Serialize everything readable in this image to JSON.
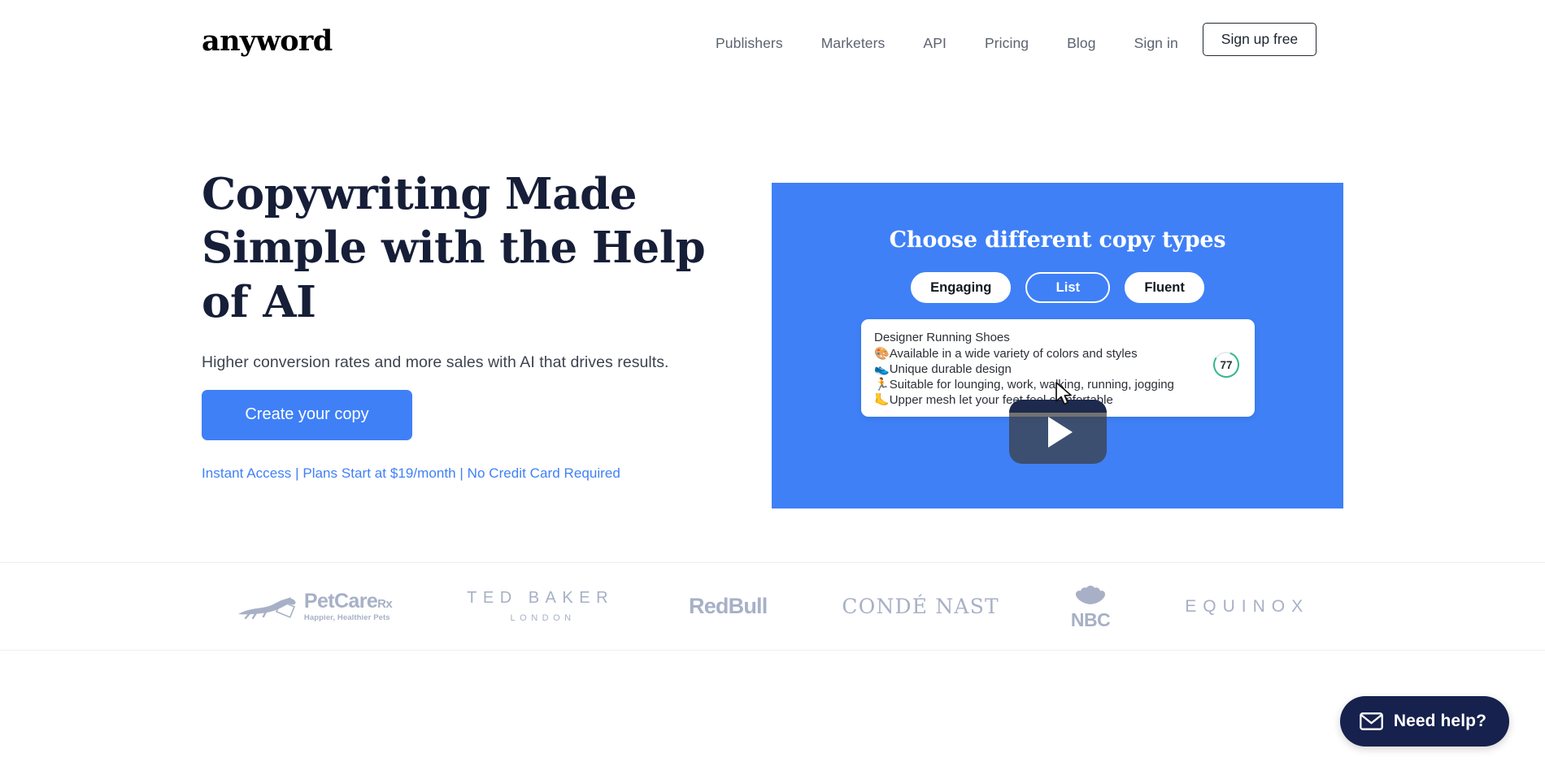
{
  "header": {
    "logo": "anyword",
    "nav": [
      {
        "label": "Publishers",
        "name": "nav-publishers"
      },
      {
        "label": "Marketers",
        "name": "nav-marketers"
      },
      {
        "label": "API",
        "name": "nav-api"
      },
      {
        "label": "Pricing",
        "name": "nav-pricing"
      },
      {
        "label": "Blog",
        "name": "nav-blog"
      }
    ],
    "sign_in": "Sign in",
    "sign_up": "Sign up free"
  },
  "hero": {
    "headline": "Copywriting Made Simple with the Help of AI",
    "subhead": "Higher conversion rates and more sales with AI that drives results.",
    "cta_label": "Create your copy",
    "cta_note": "Instant Access | Plans Start at $19/month | No Credit Card Required"
  },
  "video": {
    "title": "Choose different copy types",
    "pills": [
      {
        "label": "Engaging",
        "state": "filled"
      },
      {
        "label": "List",
        "state": "outlined"
      },
      {
        "label": "Fluent",
        "state": "filled"
      }
    ],
    "card": {
      "title": "Designer Running Shoes",
      "lines": [
        {
          "emoji": "🎨",
          "text": "Available in a wide variety of colors and styles"
        },
        {
          "emoji": "👟",
          "text": "Unique durable design"
        },
        {
          "emoji": "🏃",
          "text": "Suitable for lounging, work, walking, running, jogging"
        },
        {
          "emoji": "🦶",
          "text": "Upper mesh let your feet feel comfortable"
        }
      ],
      "score": "77"
    },
    "play_button": "play-button"
  },
  "logos": {
    "petcarerx": {
      "name": "PetCare",
      "suffix": "Rx",
      "tagline": "Happier, Healthier Pets"
    },
    "ted_baker": {
      "main": "TED BAKER",
      "sub": "LONDON"
    },
    "redbull": "RedBull",
    "conde_nast": "CONDÉ NAST",
    "nbc": "NBC",
    "equinox": "EQUINOX"
  },
  "help": {
    "label": "Need help?"
  },
  "colors": {
    "accent_blue": "#3f80f7",
    "headline_navy": "#161e38",
    "help_navy": "#16214d",
    "logo_gray": "#a7b0c6",
    "score_green": "#35b888"
  }
}
